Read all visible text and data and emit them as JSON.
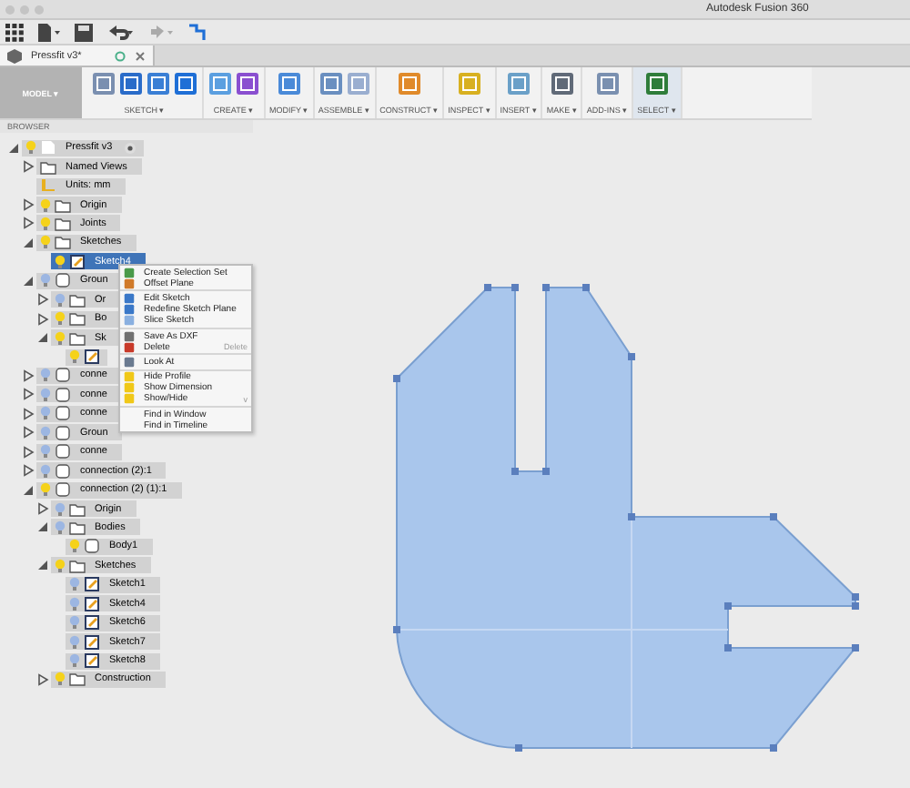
{
  "window": {
    "title": "Autodesk Fusion 360"
  },
  "document_tab": {
    "label": "Pressfit v3*",
    "selected": true
  },
  "ribbon": {
    "workspace": "MODEL ▾",
    "groups": [
      {
        "label": "SKETCH ▾",
        "selected": false,
        "kind": "sketch"
      },
      {
        "label": "CREATE ▾",
        "selected": false,
        "kind": "create"
      },
      {
        "label": "MODIFY ▾",
        "selected": false,
        "kind": "modify"
      },
      {
        "label": "ASSEMBLE ▾",
        "selected": false,
        "kind": "assemble"
      },
      {
        "label": "CONSTRUCT ▾",
        "selected": false,
        "kind": "construct"
      },
      {
        "label": "INSPECT ▾",
        "selected": false,
        "kind": "inspect"
      },
      {
        "label": "INSERT ▾",
        "selected": false,
        "kind": "insert"
      },
      {
        "label": "MAKE ▾",
        "selected": false,
        "kind": "make"
      },
      {
        "label": "ADD-INS ▾",
        "selected": false,
        "kind": "addins"
      },
      {
        "label": "SELECT ▾",
        "selected": true,
        "kind": "select"
      }
    ]
  },
  "browser": {
    "title": "BROWSER",
    "tree": [
      {
        "label": "Pressfit v3",
        "kind": "root",
        "visible": true,
        "expanded": true,
        "selected": false,
        "children": [
          {
            "label": "Named Views",
            "kind": "folder",
            "expanded": false,
            "selected": false
          },
          {
            "label": "Units: mm",
            "kind": "units",
            "selected": false
          },
          {
            "label": "Origin",
            "kind": "folder",
            "visible": true,
            "expanded": false,
            "selected": false
          },
          {
            "label": "Joints",
            "kind": "folder",
            "visible": true,
            "expanded": false,
            "selected": false
          },
          {
            "label": "Sketches",
            "kind": "folder",
            "visible": true,
            "expanded": true,
            "selected": false,
            "children": [
              {
                "label": "Sketch4",
                "kind": "sketch",
                "visible": true,
                "selected": true
              }
            ]
          },
          {
            "label": "Groun",
            "kind": "component",
            "visible": false,
            "expanded": true,
            "selected": false,
            "children": [
              {
                "label": "Or",
                "kind": "folder",
                "visible": false,
                "expanded": false,
                "selected": false
              },
              {
                "label": "Bo",
                "kind": "folder",
                "visible": true,
                "expanded": false,
                "selected": false
              },
              {
                "label": "Sk",
                "kind": "folder",
                "visible": true,
                "expanded": true,
                "selected": false,
                "children": [
                  {
                    "kind": "sketch",
                    "visible": true,
                    "selected": false
                  }
                ]
              }
            ]
          },
          {
            "label": "conne",
            "kind": "component",
            "visible": false,
            "expanded": false,
            "selected": false
          },
          {
            "label": "conne",
            "kind": "component",
            "visible": false,
            "expanded": false,
            "selected": false
          },
          {
            "label": "conne",
            "kind": "component",
            "visible": false,
            "expanded": false,
            "selected": false
          },
          {
            "label": "Groun",
            "kind": "component",
            "visible": false,
            "expanded": false,
            "selected": false
          },
          {
            "label": "conne",
            "kind": "component",
            "visible": false,
            "expanded": false,
            "selected": false
          },
          {
            "label": "connection (2):1",
            "kind": "component",
            "visible": false,
            "expanded": false,
            "selected": false
          },
          {
            "label": "connection (2) (1):1",
            "kind": "component",
            "visible": true,
            "expanded": true,
            "selected": false,
            "children": [
              {
                "label": "Origin",
                "kind": "folder",
                "visible": false,
                "expanded": false,
                "selected": false
              },
              {
                "label": "Bodies",
                "kind": "folder",
                "visible": false,
                "expanded": true,
                "selected": false,
                "children": [
                  {
                    "label": "Body1",
                    "kind": "body",
                    "visible": true,
                    "selected": false
                  }
                ]
              },
              {
                "label": "Sketches",
                "kind": "folder",
                "visible": true,
                "expanded": true,
                "selected": false,
                "children": [
                  {
                    "label": "Sketch1",
                    "kind": "sketch",
                    "visible": false,
                    "selected": false
                  },
                  {
                    "label": "Sketch4",
                    "kind": "sketch",
                    "visible": false,
                    "selected": false
                  },
                  {
                    "label": "Sketch6",
                    "kind": "sketch",
                    "visible": false,
                    "selected": false
                  },
                  {
                    "label": "Sketch7",
                    "kind": "sketch",
                    "visible": false,
                    "selected": false
                  },
                  {
                    "label": "Sketch8",
                    "kind": "sketch",
                    "visible": false,
                    "selected": false
                  }
                ]
              },
              {
                "label": "Construction",
                "kind": "folder",
                "visible": true,
                "expanded": false,
                "selected": false
              }
            ]
          }
        ]
      }
    ]
  },
  "context_menu": {
    "sections": [
      [
        {
          "label": "Create Selection Set",
          "kind": "selection"
        },
        {
          "label": "Offset Plane",
          "kind": "plane"
        }
      ],
      [
        {
          "label": "Edit Sketch",
          "kind": "sketch"
        },
        {
          "label": "Redefine Sketch Plane",
          "kind": "sketch"
        },
        {
          "label": "Slice Sketch",
          "kind": "slice"
        }
      ],
      [
        {
          "label": "Save As DXF",
          "kind": "save"
        },
        {
          "label": "Delete",
          "kind": "delete",
          "shortcut": "Delete"
        }
      ],
      [
        {
          "label": "Look At",
          "kind": "camera"
        }
      ],
      [
        {
          "label": "Hide Profile",
          "kind": "bulb"
        },
        {
          "label": "Show Dimension",
          "kind": "bulb"
        },
        {
          "label": "Show/Hide",
          "kind": "bulb",
          "submenu": "v"
        }
      ],
      [
        {
          "label": "Find in Window",
          "kind": "plain"
        },
        {
          "label": "Find in Timeline",
          "kind": "plain"
        }
      ]
    ]
  }
}
